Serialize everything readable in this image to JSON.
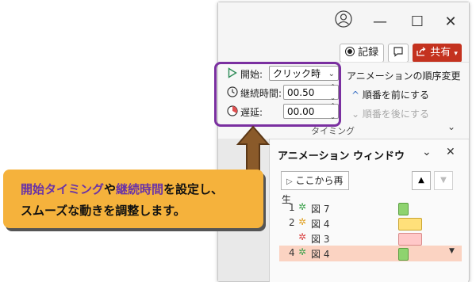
{
  "window": {
    "user_icon": "person-icon",
    "minimize_glyph": "—",
    "maximize_glyph": "☐",
    "close_glyph": "✕"
  },
  "toolbar": {
    "record_label": "記録",
    "comment_icon": "comment-icon",
    "share_label": "共有"
  },
  "ribbon": {
    "start_label": "開始:",
    "start_value": "クリック時",
    "duration_label": "継続時間:",
    "duration_value": "00.50",
    "delay_label": "遅延:",
    "delay_value": "00.00",
    "reorder_title": "アニメーションの順序変更",
    "move_earlier": "順番を前にする",
    "move_later": "順番を後にする",
    "group_label": "タイミング"
  },
  "pane": {
    "title": "アニメーション ウィンドウ",
    "play_label": "ここから再生",
    "items": [
      {
        "num": "1",
        "name": "図 7",
        "bar_color": "#8ed36f",
        "bar_border": "#5a9e40"
      },
      {
        "num": "2",
        "name": "図 4",
        "bar_color": "#ffe07a",
        "bar_border": "#c9a430"
      },
      {
        "num": "",
        "name": "図 3",
        "bar_color": "#ffc8c8",
        "bar_border": "#d98a8a"
      },
      {
        "num": "4",
        "name": "図 4",
        "bar_color": "#8ed36f",
        "bar_border": "#5a9e40"
      }
    ]
  },
  "callout": {
    "part1": "開始タイミング",
    "part2": "や",
    "part3": "継続時間",
    "part4": "を設定し、",
    "line2": "スムーズな動きを調整します。"
  },
  "colors": {
    "highlight": "#7a2fa0",
    "callout_bg": "#f5b23c",
    "share_bg": "#c4321f",
    "selected_row": "#fbd3c2"
  }
}
